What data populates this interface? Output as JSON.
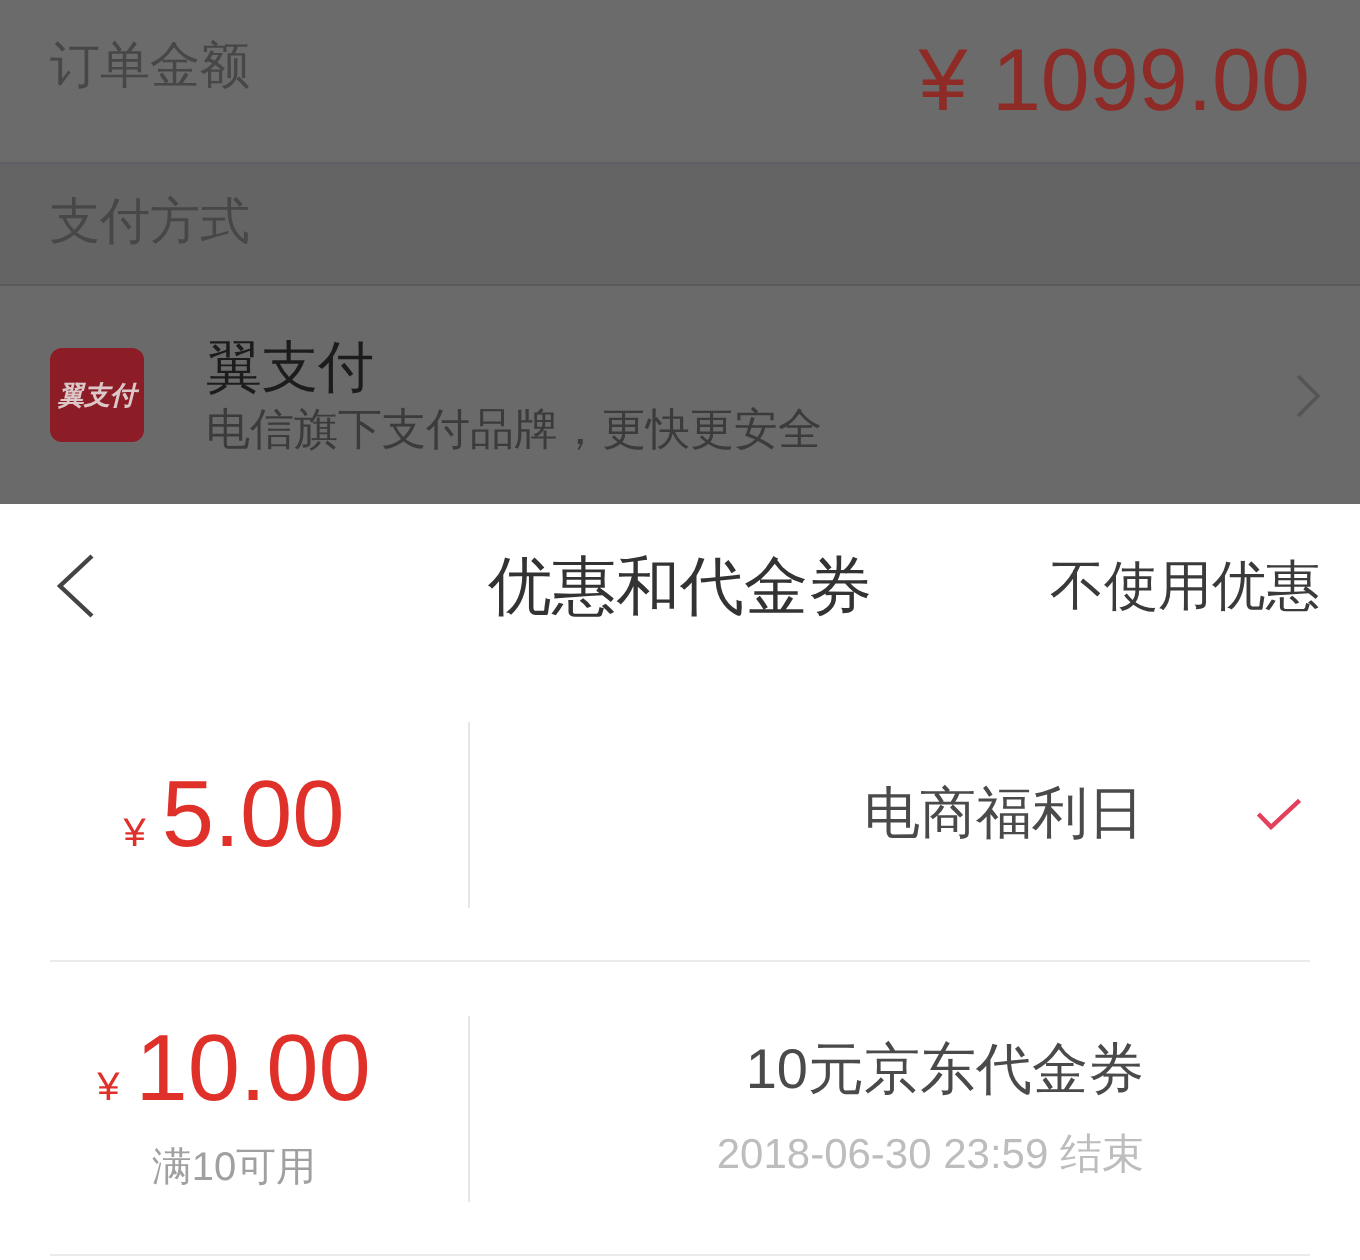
{
  "order": {
    "label": "订单金额",
    "amount": "¥ 1099.00"
  },
  "payment_section": {
    "title": "支付方式"
  },
  "payment_method": {
    "logo_text": "翼支付",
    "name": "翼支付",
    "description": "电信旗下支付品牌，更快更安全"
  },
  "sheet": {
    "title": "优惠和代金券",
    "action": "不使用优惠"
  },
  "coupons": [
    {
      "currency": "¥",
      "amount": "5.00",
      "title": "电商福利日",
      "selected": true
    },
    {
      "currency": "¥",
      "amount": "10.00",
      "condition": "满10可用",
      "title": "10元京东代金券",
      "expiry": "2018-06-30 23:59 结束",
      "selected": false
    }
  ]
}
